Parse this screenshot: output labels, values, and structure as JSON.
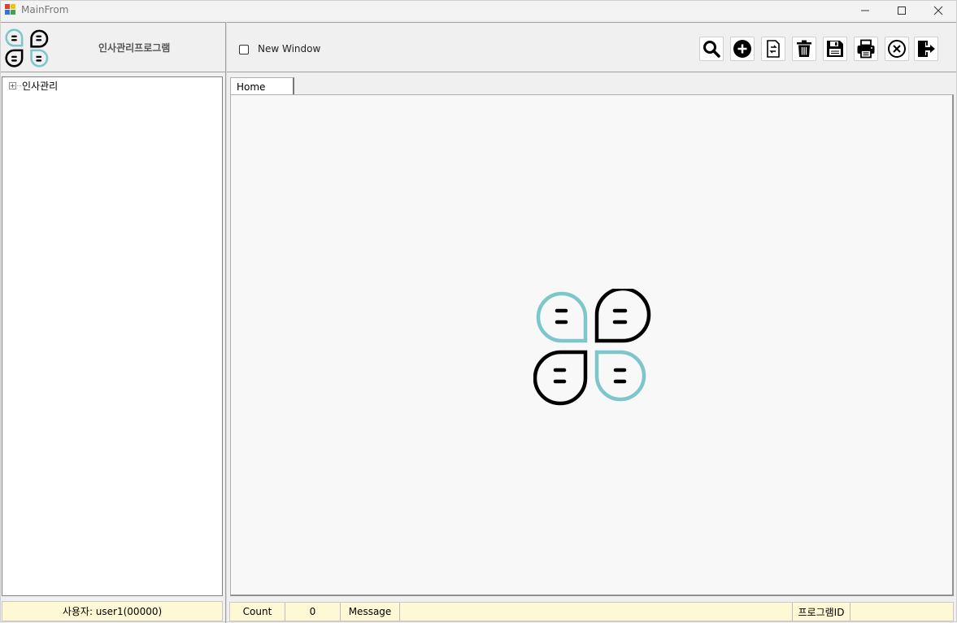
{
  "window": {
    "title": "MainFrom"
  },
  "header": {
    "app_name": "인사관리프로그램",
    "new_window_label": "New Window",
    "new_window_checked": false,
    "toolbar": [
      {
        "name": "search-button",
        "icon": "search-icon"
      },
      {
        "name": "add-button",
        "icon": "plus-circle-icon"
      },
      {
        "name": "edit-button",
        "icon": "document-swap-icon"
      },
      {
        "name": "delete-button",
        "icon": "trash-icon"
      },
      {
        "name": "save-button",
        "icon": "floppy-disk-icon"
      },
      {
        "name": "print-button",
        "icon": "printer-icon"
      },
      {
        "name": "close-form-button",
        "icon": "x-circle-icon"
      },
      {
        "name": "exit-button",
        "icon": "exit-door-icon"
      }
    ]
  },
  "tree": {
    "root": {
      "label": "인사관리",
      "expander": "+"
    }
  },
  "tabs": [
    {
      "label": "Home"
    }
  ],
  "status": {
    "user": "사용자: user1(00000)",
    "count_label": "Count",
    "count_value": "0",
    "message_label": "Message",
    "message_value": "",
    "program_id_label": "프로그램ID",
    "program_id_value": ""
  },
  "colors": {
    "logo_teal": "#7cc6cc",
    "logo_black": "#000000",
    "status_bg": "#fff8d4",
    "content_bg": "#f8f8f8"
  }
}
